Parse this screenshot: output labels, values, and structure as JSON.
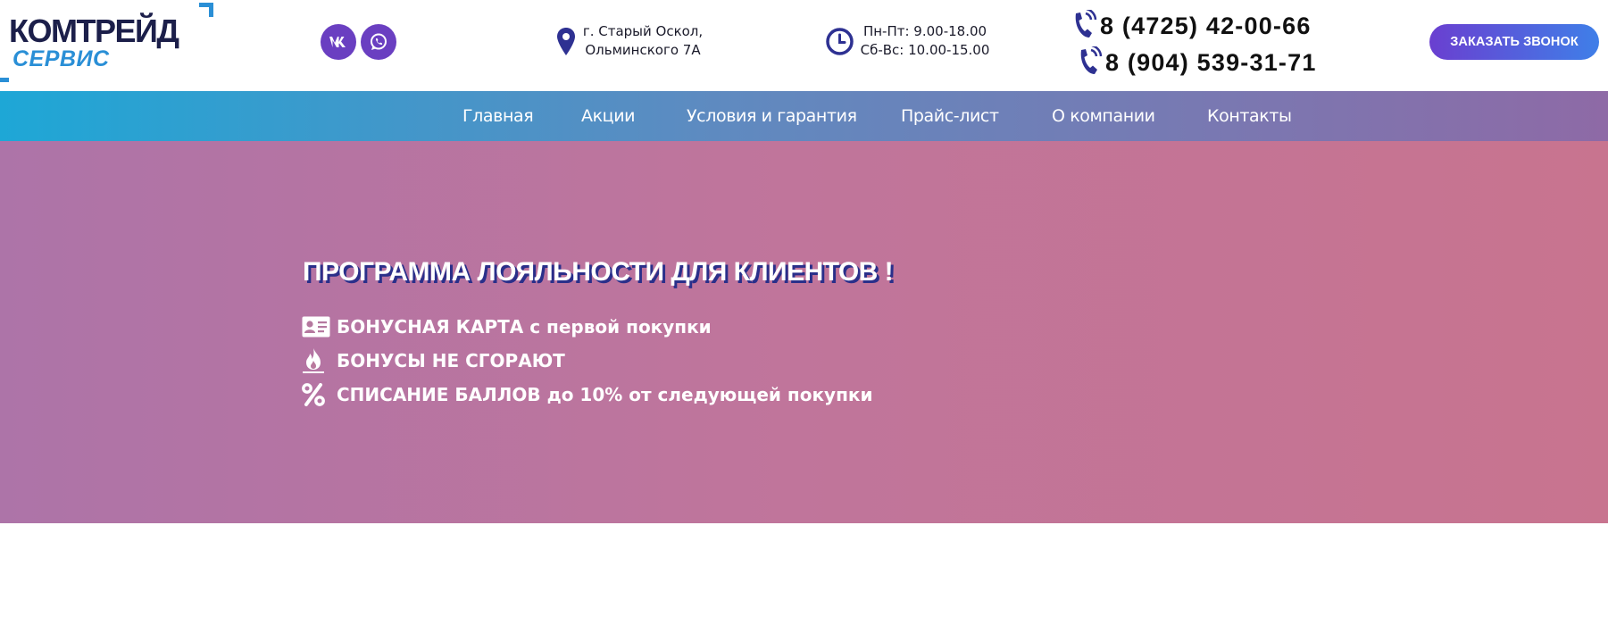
{
  "header": {
    "logo": {
      "line1": "КОМТРЕЙД",
      "line2": "СЕРВИС"
    },
    "social": [
      {
        "name": "vk",
        "icon": "vk-icon"
      },
      {
        "name": "whatsapp",
        "icon": "whatsapp-icon"
      }
    ],
    "address": {
      "line1": "г. Старый Оскол,",
      "line2": "Ольминского 7А"
    },
    "hours": {
      "line1": "Пн-Пт: 9.00-18.00",
      "line2": "Сб-Вс: 10.00-15.00"
    },
    "phones": [
      "8 (4725) 42-00-66",
      "8 (904) 539-31-71"
    ],
    "call_button": "ЗАКАЗАТЬ ЗВОНОК"
  },
  "nav": {
    "items": [
      "Главная",
      "Акции",
      "Условия и гарантия",
      "Прайс-лист",
      "О компании",
      "Контакты"
    ]
  },
  "hero": {
    "title": "ПРОГРАММА ЛОЯЛЬНОСТИ ДЛЯ КЛИЕНТОВ !",
    "features": [
      {
        "icon": "id-card-icon",
        "text": "БОНУСНАЯ КАРТА с первой покупки"
      },
      {
        "icon": "flame-icon",
        "text": "БОНУСЫ НЕ СГОРАЮТ"
      },
      {
        "icon": "percent-icon",
        "text": "СПИСАНИЕ БАЛЛОВ до 10% от следующей покупки"
      }
    ]
  },
  "colors": {
    "brand_dark": "#1c1f4a",
    "brand_blue": "#2a8fd6",
    "social_purple": "#6a3fc1",
    "phone_icon": "#2e3192",
    "title_shadow": "#2a2f8a"
  }
}
